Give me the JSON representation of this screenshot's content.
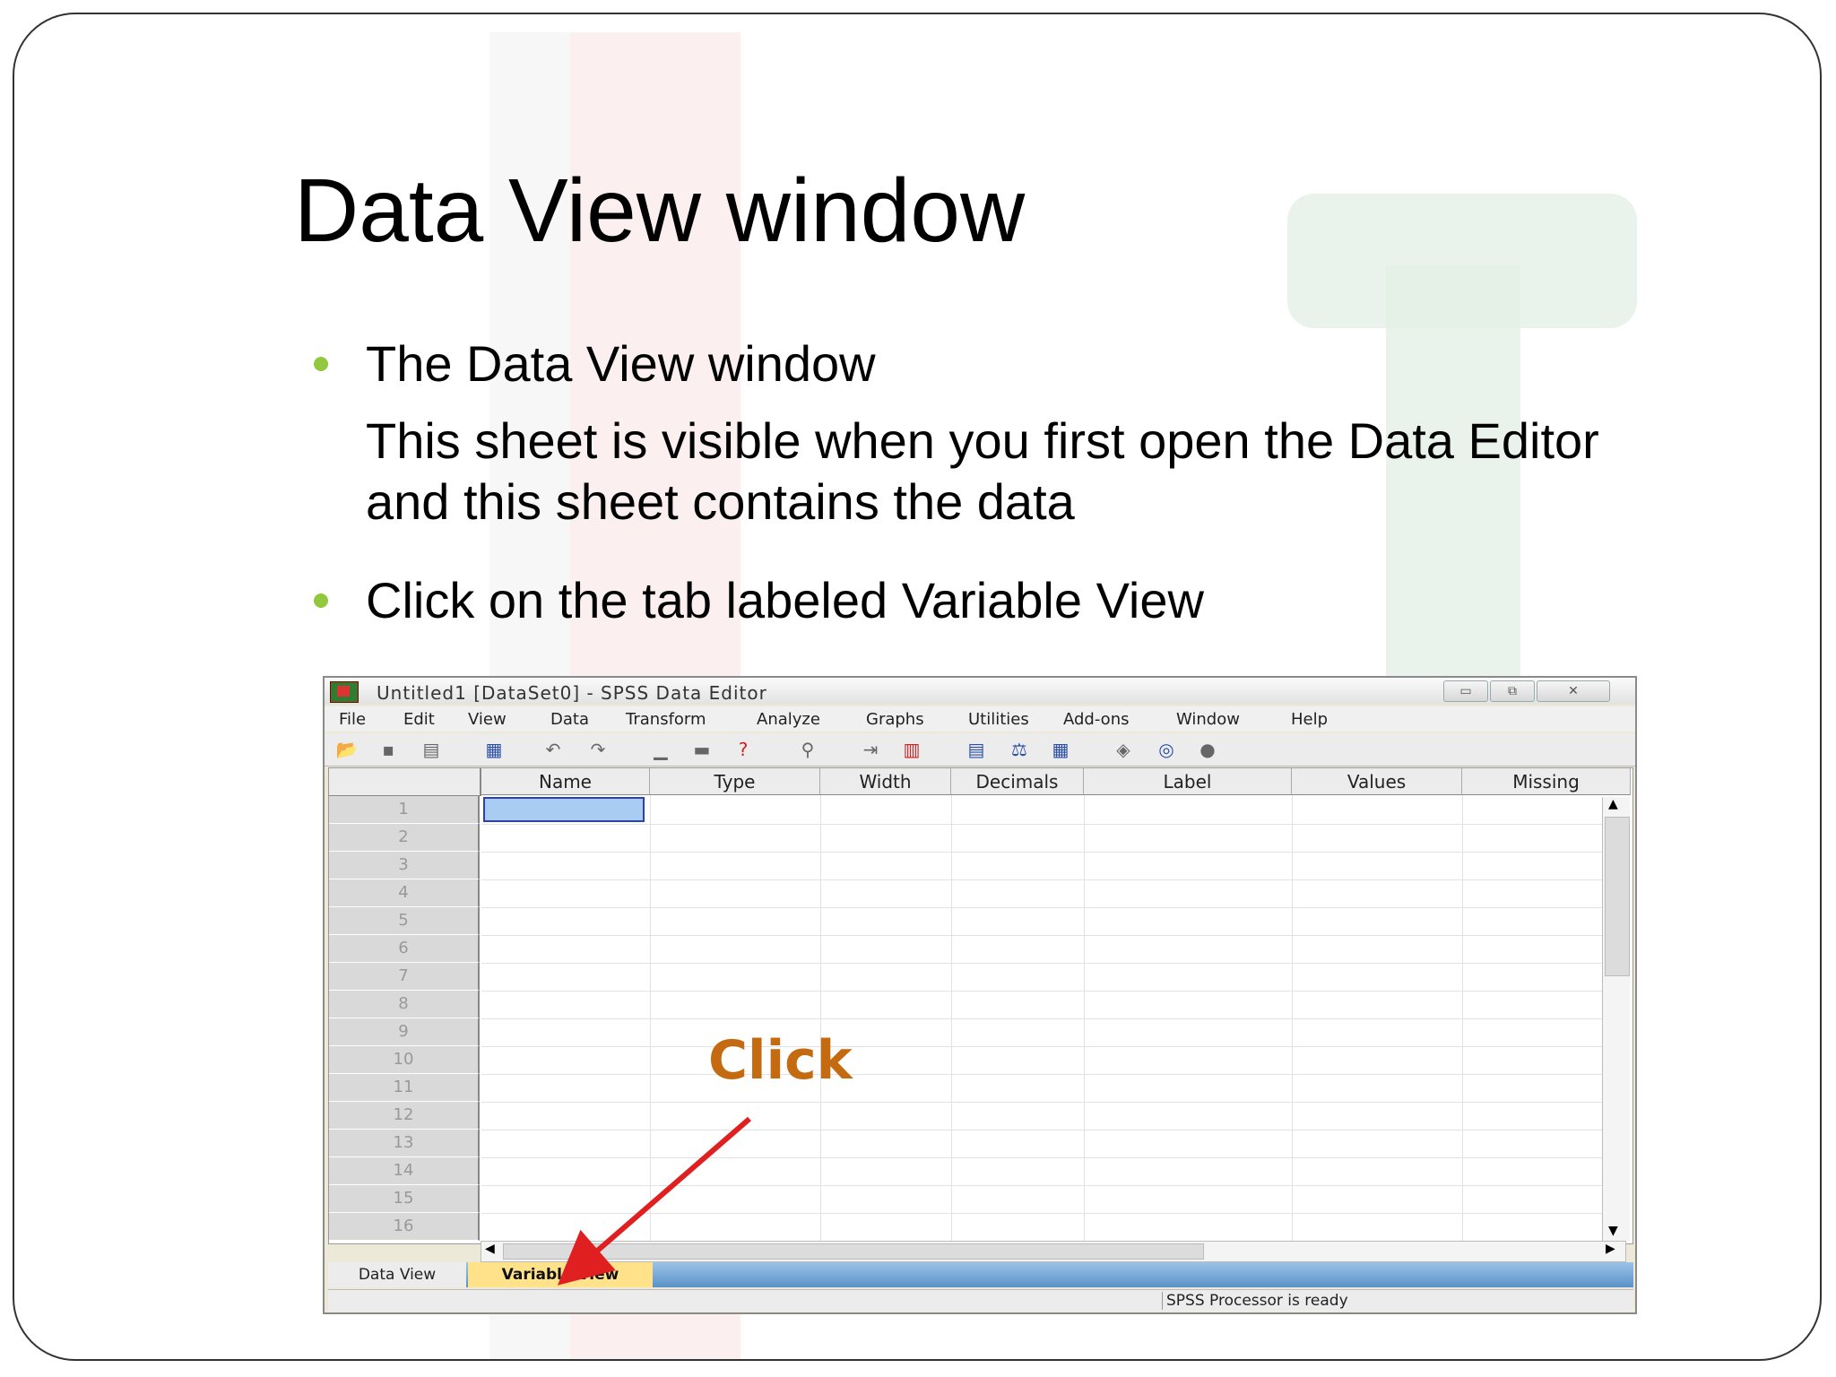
{
  "slide": {
    "title": "Data View window",
    "bullets": [
      {
        "heading": "The Data View window",
        "body": "This sheet is visible when you first open the Data Editor and this sheet contains the data"
      },
      {
        "heading": "Click on the tab labeled Variable View"
      }
    ],
    "click_label": "Click",
    "accent_color": "#92c83e",
    "arrow_color": "#e02020"
  },
  "window": {
    "title": "Untitled1 [DataSet0] - SPSS Data Editor",
    "buttons": {
      "minimize": "▭",
      "restore": "⧉",
      "close": "✕"
    },
    "menu": [
      "File",
      "Edit",
      "View",
      "Data",
      "Transform",
      "Analyze",
      "Graphs",
      "Utilities",
      "Add-ons",
      "Window",
      "Help"
    ],
    "toolbar_icons": [
      "open-folder",
      "save",
      "print",
      "dialog-recall",
      "undo",
      "redo",
      "goto-case",
      "goto-variable",
      "variables",
      "find",
      "insert-cases",
      "insert-variable",
      "split-file",
      "weight-cases",
      "select-cases",
      "value-labels",
      "use-sets",
      "show-all"
    ],
    "columns": [
      "Name",
      "Type",
      "Width",
      "Decimals",
      "Label",
      "Values",
      "Missing"
    ],
    "rows": [
      "1",
      "2",
      "3",
      "4",
      "5",
      "6",
      "7",
      "8",
      "9",
      "10",
      "11",
      "12",
      "13",
      "14",
      "15",
      "16"
    ],
    "tabs": {
      "data_view": "Data View",
      "variable_view": "Variable View"
    },
    "status": "SPSS  Processor is ready"
  }
}
